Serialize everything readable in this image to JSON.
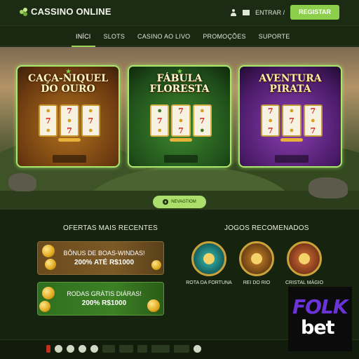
{
  "header": {
    "logo_text": "CASSINO ONLINE",
    "entrar": "ENTRAR /",
    "registar": "REGISTAR"
  },
  "nav": {
    "items": [
      "INÍCI",
      "SLOTS",
      "CASINO AO LIVO",
      "PROMOÇÕES",
      "SUPORTE"
    ],
    "active": "INÍCI"
  },
  "hero": {
    "cards": [
      {
        "title_line1": "CAÇA-NIQUEL",
        "title_line2": "DO OURO",
        "reels": [
          [
            "7",
            "🍒",
            "7"
          ],
          [
            "7",
            "🍒",
            "7"
          ],
          [
            "🍒",
            "7",
            "🍒"
          ]
        ]
      },
      {
        "title_line1": "FÁBULA",
        "title_line2": "FLORESTA",
        "reels": [
          [
            "7",
            "🍒",
            "7"
          ],
          [
            "🍒",
            "7",
            "🍒"
          ],
          [
            "7",
            "🍒",
            "7"
          ]
        ]
      },
      {
        "title_line1": "AVENTURA",
        "title_line2": "PIRATA",
        "reels": [
          [
            "7",
            "🍒",
            "7"
          ],
          [
            "🍒",
            "7",
            "🍒"
          ],
          [
            "7",
            "🍒",
            "7"
          ]
        ]
      }
    ],
    "button_label": "NEVAGTIOM"
  },
  "offers": {
    "title": "OFERTAS MAIS RECENTES",
    "items": [
      {
        "line1": "BÔNUS DE BOAS-WINDAS!",
        "line2": "200% ATÉ R$1000"
      },
      {
        "line1": "RODAS GRÁTIS DIÁRAS!",
        "line2": "200% R$1000"
      }
    ]
  },
  "games": {
    "title": "JOGOS RECOMENADOS",
    "items": [
      {
        "label": "ROTA DA FORTUNA"
      },
      {
        "label": "REI DO RIO"
      },
      {
        "label": "CRISTAL MÁGIO"
      }
    ]
  },
  "colors": {
    "accent": "#9fd45a",
    "background": "#16230f",
    "folk_purple": "#6a34d8"
  },
  "badge": {
    "line1": "FOLK",
    "line2": "bet"
  }
}
